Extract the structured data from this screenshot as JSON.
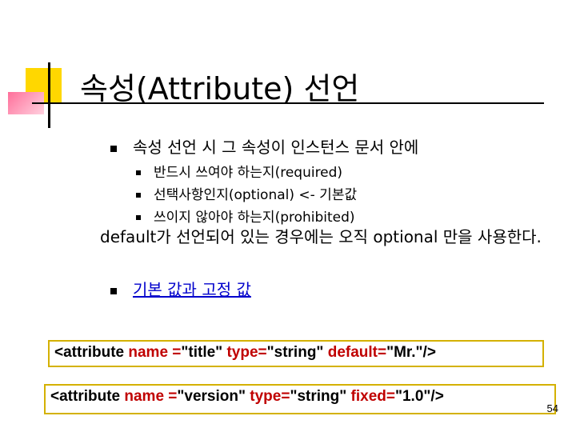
{
  "slide": {
    "title": "속성(Attribute) 선언",
    "bullet1": "속성 선언 시 그 속성이 인스턴스 문서 안에",
    "sub_items": [
      "반드시 쓰여야 하는지(required)",
      "선택사항인지(optional) <- 기본값",
      "쓰이지 않아야 하는지(prohibited)"
    ],
    "paragraph": "default가 선언되어 있는 경우에는 오직 optional 만을 사용한다.",
    "bullet2_link": "기본 값과 고정 값",
    "code1": {
      "p1": "<attribute ",
      "p2": "name =",
      "p3": "\"title\" ",
      "p4": "type=",
      "p5": "\"string\" ",
      "p6": "default=",
      "p7": "\"Mr.\"/>"
    },
    "code2": {
      "p1": "<attribute ",
      "p2": "name =",
      "p3": "\"version\" ",
      "p4": "type=",
      "p5": "\"string\" ",
      "p6": "fixed=",
      "p7": "\"1.0\"/>"
    },
    "page_number": "54"
  },
  "colors": {
    "accent_yellow": "#ffd700",
    "accent_pink": "#ff6f9a",
    "code_keyword_red": "#c00000",
    "link_blue": "#0000cc",
    "box_border": "#d4b100"
  }
}
